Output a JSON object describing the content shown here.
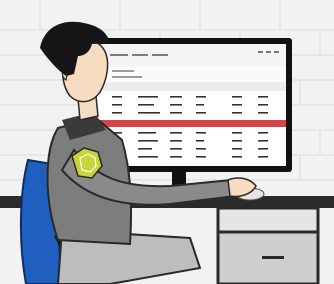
{
  "illustration": {
    "subject": "person-at-computer",
    "colors": {
      "background": "#f2f2f2",
      "wall_lines": "#d9d9d9",
      "monitor_frame": "#111111",
      "screen": "#ffffff",
      "screen_header": "#ececec",
      "highlight_row": "#d64545",
      "desk": "#2a2a2a",
      "cabinet": "#cfcfcf",
      "chair": "#1f5fbf",
      "shirt": "#7d7d7d",
      "collar": "#3a3a3a",
      "skin": "#f6dcc0",
      "hair": "#161616",
      "badge": "#c9d43a",
      "mouse": "#e6e6e6"
    },
    "icons": [
      "shield-badge-icon",
      "mouse-icon"
    ]
  }
}
